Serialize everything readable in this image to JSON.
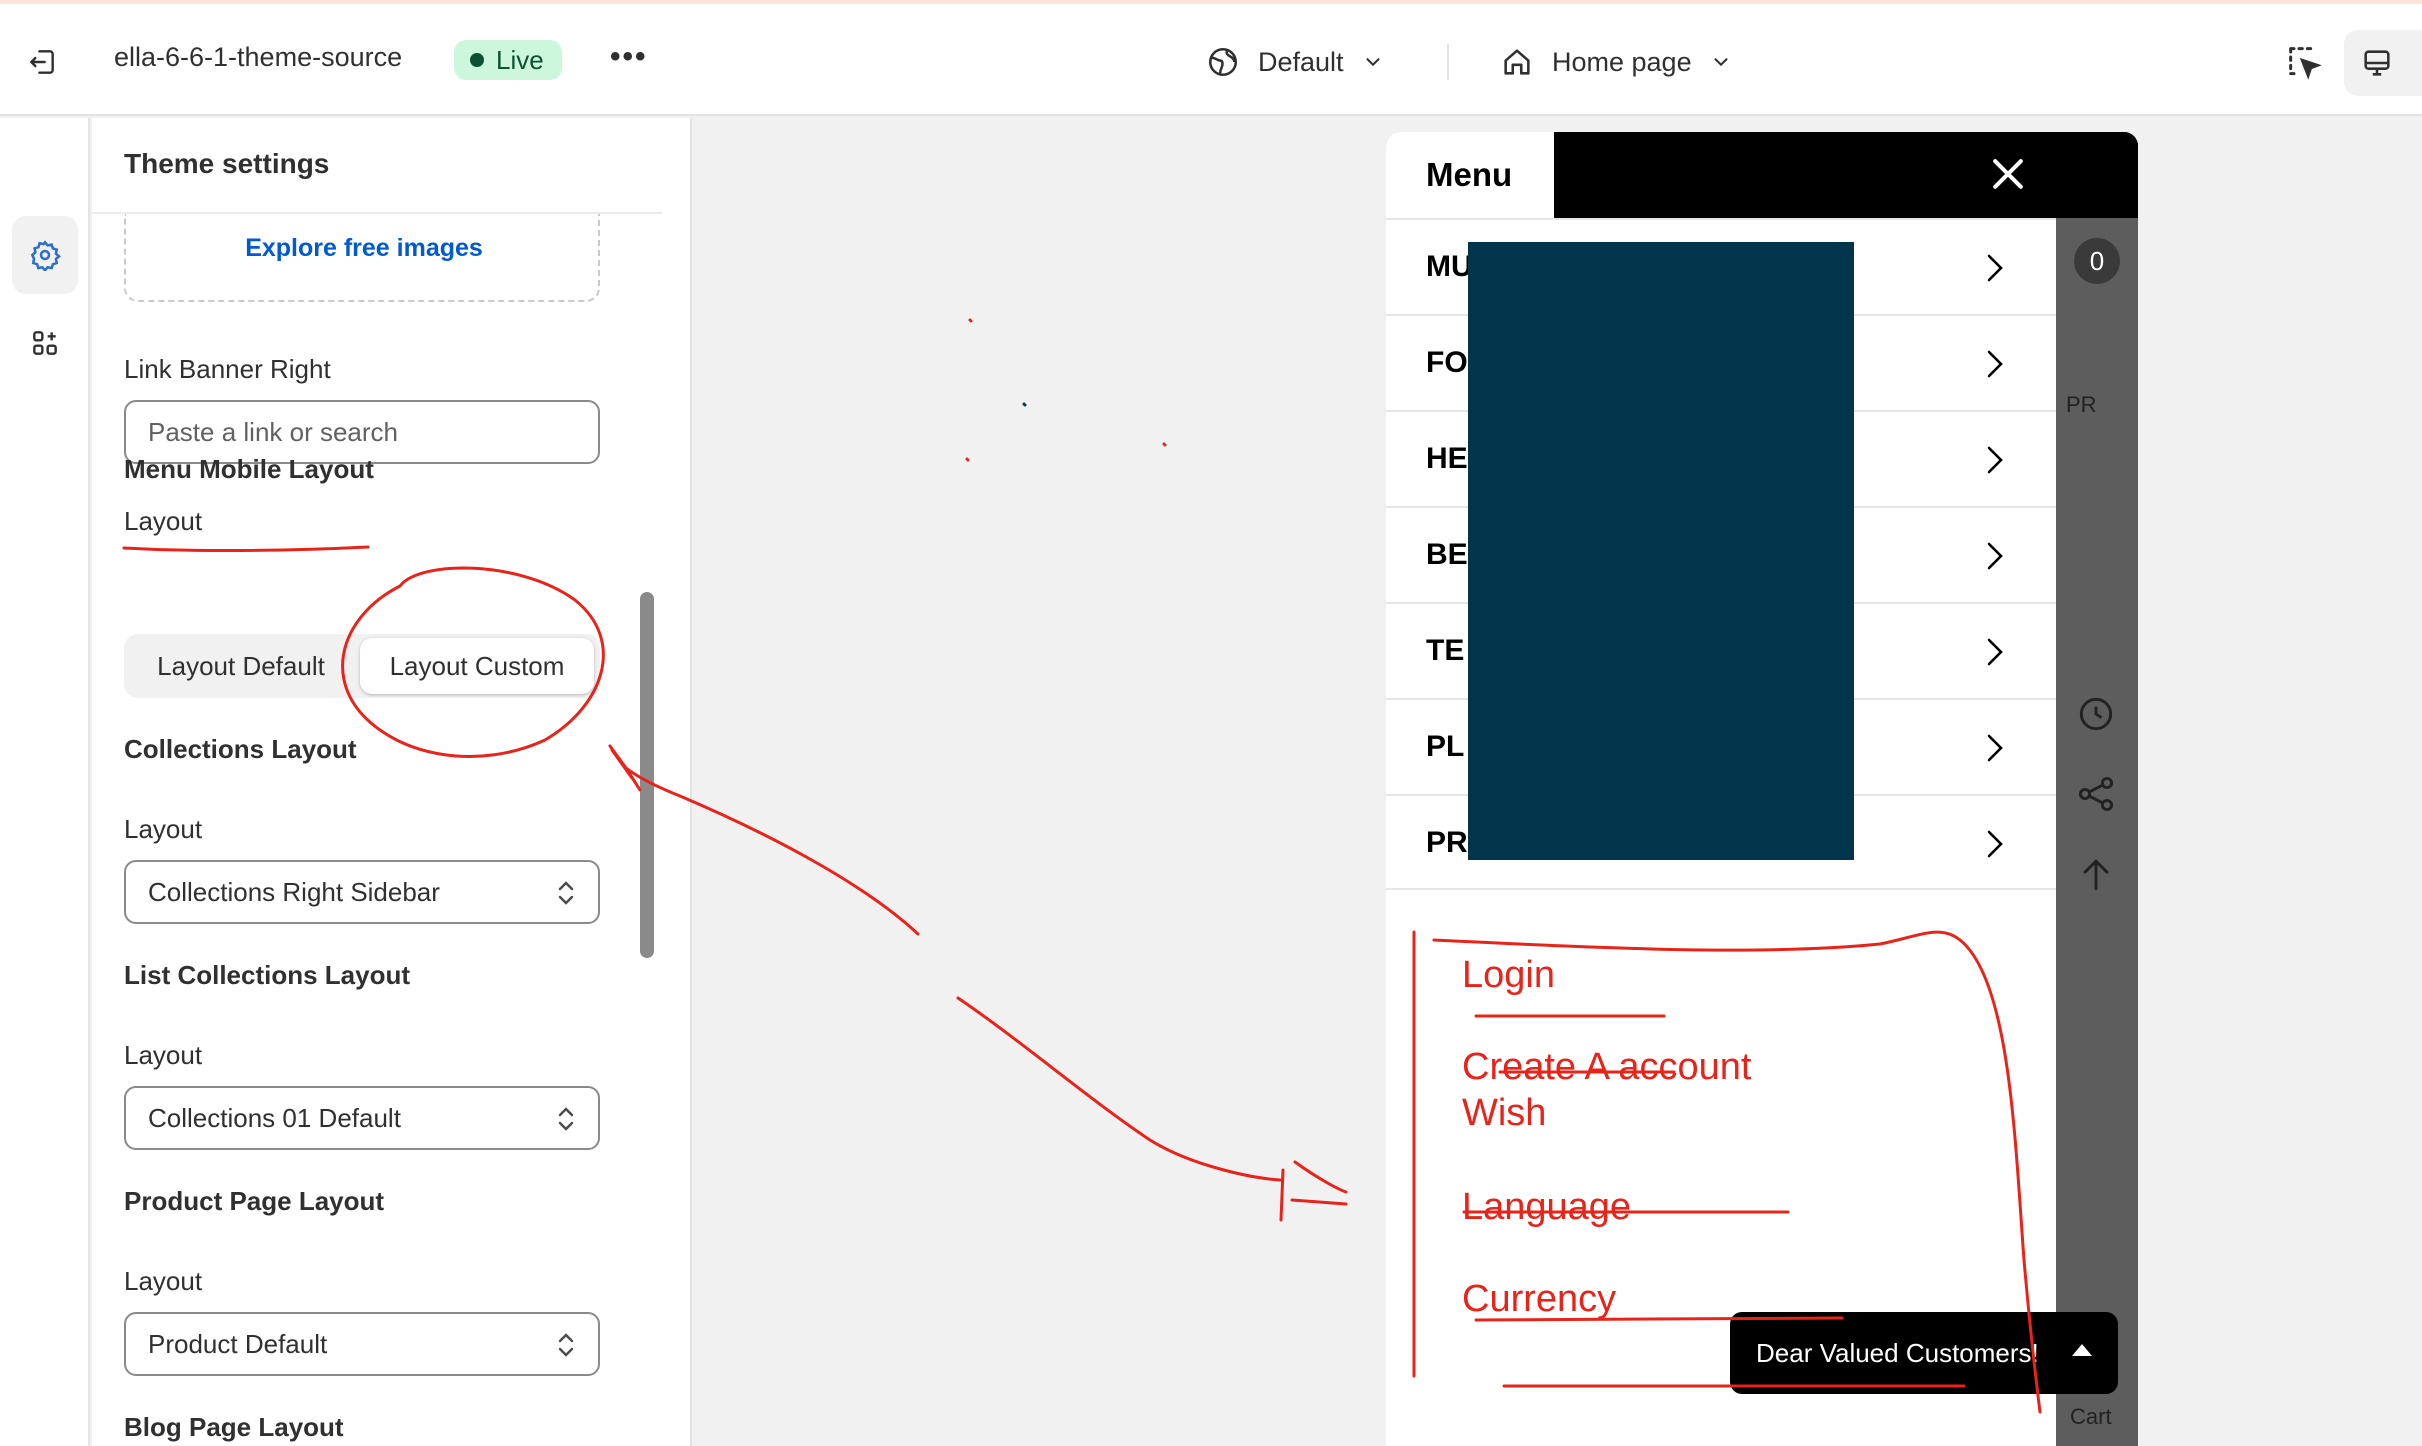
{
  "topbar": {
    "theme_name": "ella-6-6-1-theme-source",
    "status": "Live",
    "more": "•••",
    "theme_selector": "Default",
    "page_selector": "Home page"
  },
  "panel": {
    "title": "Theme settings",
    "explore_link": "Explore free images",
    "link_banner_right": {
      "label": "Link Banner Right",
      "placeholder": "Paste a link or search"
    },
    "menu_mobile": {
      "title": "Menu Mobile Layout",
      "layout_label": "Layout",
      "options": [
        "Layout Default",
        "Layout Custom"
      ],
      "selected": "Layout Custom"
    },
    "collections": {
      "title": "Collections Layout",
      "layout_label": "Layout",
      "value": "Collections Right Sidebar"
    },
    "list_collections": {
      "title": "List Collections Layout",
      "layout_label": "Layout",
      "value": "Collections 01 Default"
    },
    "product_page": {
      "title": "Product Page Layout",
      "layout_label": "Layout",
      "value": "Product Default"
    },
    "blog_page": {
      "title": "Blog Page Layout"
    }
  },
  "preview": {
    "drawer_title": "Menu",
    "menu_items": [
      "MU",
      "FO",
      "HE",
      "BE",
      "TE",
      "PL",
      "PR"
    ],
    "links": [
      "Login",
      "Create A account",
      "Wish",
      "Language",
      "Currency"
    ],
    "cart_count": "0",
    "side_text": "PR",
    "cart_label": "Cart",
    "toast": "Dear Valued Customers!"
  },
  "colors": {
    "accent_link": "#005bd3",
    "live_badge_bg": "#cdf7dd",
    "annotation_red": "#e8241a",
    "redaction": "#00354b"
  }
}
